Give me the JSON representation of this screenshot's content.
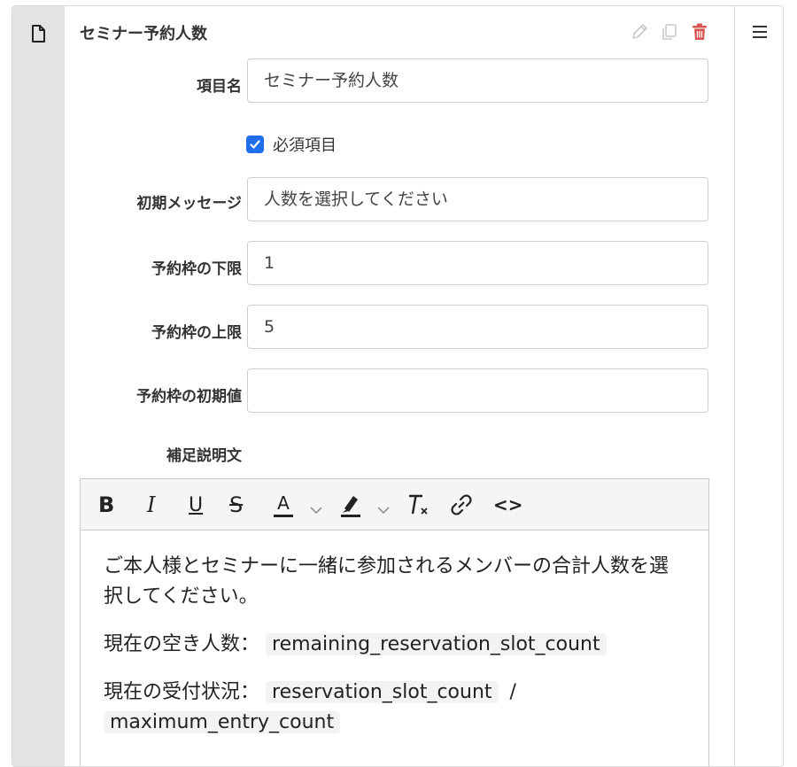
{
  "card": {
    "title": "セミナー予約人数",
    "colors": {
      "delete": "#d9534f",
      "action_muted": "#c8c8c8",
      "checkbox": "#1f6feb"
    }
  },
  "form": {
    "item_name": {
      "label": "項目名",
      "value": "セミナー予約人数"
    },
    "required": {
      "label": "必須項目",
      "checked": true
    },
    "initial_message": {
      "label": "初期メッセージ",
      "value": "人数を選択してください"
    },
    "slot_min": {
      "label": "予約枠の下限",
      "value": "1"
    },
    "slot_max": {
      "label": "予約枠の上限",
      "value": "5"
    },
    "slot_initial": {
      "label": "予約枠の初期値",
      "value": ""
    },
    "supplement": {
      "label": "補足説明文"
    }
  },
  "toolbar": {
    "bold": "B",
    "italic": "I",
    "underline": "U",
    "strike": "S",
    "font_color": "A",
    "code_view": "<>"
  },
  "editor": {
    "para1": "ご本人様とセミナーに一緒に参加されるメンバーの合計人数を選択してください。",
    "para2_prefix": "現在の空き人数：",
    "para2_code": "remaining_reservation_slot_count",
    "para3_prefix": "現在の受付状況：",
    "para3_code1": "reservation_slot_count",
    "para3_sep": "/",
    "para3_code2": "maximum_entry_count"
  }
}
